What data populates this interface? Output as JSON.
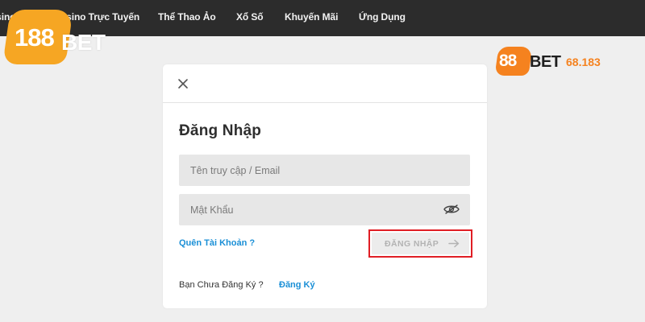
{
  "nav": {
    "items": [
      {
        "label": "Casino"
      },
      {
        "label": "Casino Trực Tuyến"
      },
      {
        "label": "Thể Thao Ảo"
      },
      {
        "label": "Xổ Số"
      },
      {
        "label": "Khuyến Mãi"
      },
      {
        "label": "Ứng Dụng"
      }
    ]
  },
  "logos": {
    "main": {
      "part1": "188",
      "part2": "BET"
    },
    "secondary": {
      "part1": "88",
      "part2": "BET",
      "part3": "68.183"
    }
  },
  "login": {
    "title": "Đăng Nhập",
    "username_placeholder": "Tên truy cập / Email",
    "password_placeholder": "Mật Khẩu",
    "forgot_link": "Quên Tài Khoản ?",
    "submit_label": "ĐĂNG NHẬP",
    "signup_prompt": "Bạn Chưa Đăng Ký ?",
    "signup_link": "Đăng Ký"
  },
  "icons": {
    "close": "close-icon",
    "eye": "eye-icon",
    "arrow": "arrow-right-icon"
  },
  "colors": {
    "topbar": "#2c2c2c",
    "brand_orange": "#f6a623",
    "secondary_orange": "#f5821f",
    "link_blue": "#1a8fd6",
    "highlight_red": "#e01e25",
    "field_bg": "#e7e7e7"
  }
}
